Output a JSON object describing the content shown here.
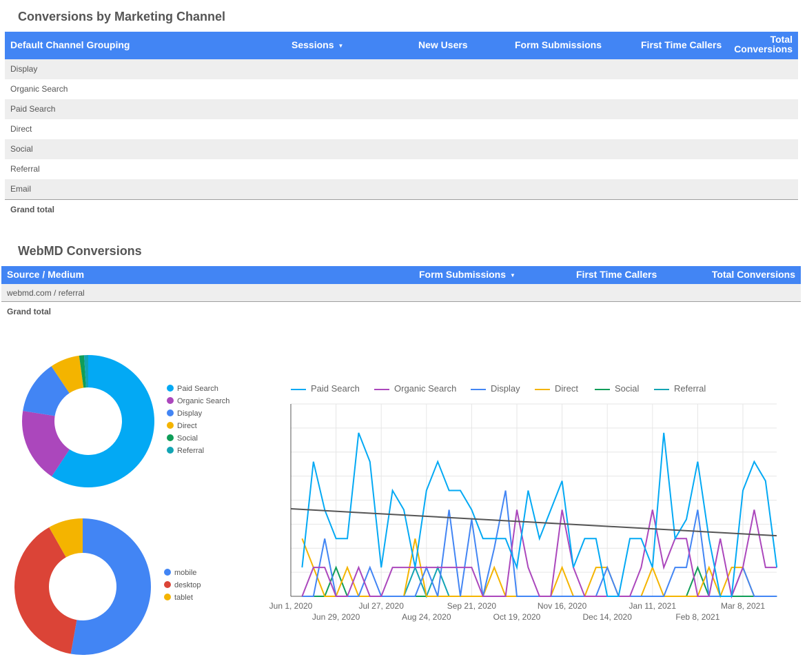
{
  "channel_table": {
    "title": "Conversions by Marketing Channel",
    "columns": [
      "Default Channel Grouping",
      "Sessions",
      "New Users",
      "Form Submissions",
      "First Time Callers",
      "Total",
      "Conversions"
    ],
    "sort_column": "Sessions",
    "rows": [
      "Display",
      "Organic Search",
      "Paid Search",
      "Direct",
      "Social",
      "Referral",
      "Email"
    ],
    "grand_total": "Grand total"
  },
  "webmd_table": {
    "title": "WebMD Conversions",
    "columns": [
      "Source / Medium",
      "Form Submissions",
      "First Time Callers",
      "Total Conversions"
    ],
    "sort_column": "Form Submissions",
    "rows": [
      "webmd.com / referral"
    ],
    "grand_total": "Grand total"
  },
  "colors": {
    "header_blue": "#4285f4",
    "paid_search": "#03a9f4",
    "organic_search": "#ab47bc",
    "display": "#4285f4",
    "direct": "#f4b400",
    "social": "#0f9d58",
    "referral": "#12a4b4",
    "mobile": "#4285f4",
    "desktop": "#db4437",
    "tablet": "#f4b400",
    "trend": "#555555"
  },
  "chart_data": [
    {
      "type": "pie",
      "variant": "donut",
      "title": "",
      "labels": [
        "Paid Search",
        "Organic Search",
        "Display",
        "Direct",
        "Social",
        "Referral"
      ],
      "values": [
        59.3,
        18.2,
        13.1,
        7.2,
        1.2,
        1.0
      ],
      "colors": [
        "#03a9f4",
        "#ab47bc",
        "#4285f4",
        "#f4b400",
        "#0f9d58",
        "#12a4b4"
      ],
      "legend": "right"
    },
    {
      "type": "pie",
      "variant": "donut",
      "title": "",
      "labels": [
        "mobile",
        "desktop",
        "tablet"
      ],
      "values": [
        52.8,
        39.0,
        8.2
      ],
      "colors": [
        "#4285f4",
        "#db4437",
        "#f4b400"
      ],
      "legend": "right"
    },
    {
      "type": "line",
      "title": "",
      "xlabel": "",
      "ylabel": "",
      "legend": "top",
      "grid": true,
      "x_tick_labels": [
        "Jun 1, 2020",
        "Jun 29, 2020",
        "Jul 27, 2020",
        "Aug 24, 2020",
        "Sep 21, 2020",
        "Oct 19, 2020",
        "Nov 16, 2020",
        "Dec 14, 2020",
        "Jan 11, 2021",
        "Feb 8, 2021",
        "Mar 8, 2021"
      ],
      "x_range_weeks": [
        0,
        43
      ],
      "ylim": [
        0,
        20
      ],
      "series": [
        {
          "name": "Paid Search",
          "color": "#03a9f4",
          "values": [
            3,
            14,
            9,
            6,
            6,
            17,
            14,
            3,
            11,
            9,
            3,
            11,
            14,
            11,
            11,
            9,
            6,
            6,
            6,
            3,
            11,
            6,
            9,
            12,
            3,
            6,
            6,
            0,
            0,
            6,
            6,
            3,
            17,
            6,
            8,
            14,
            6,
            0,
            0,
            11,
            14,
            12,
            3
          ]
        },
        {
          "name": "Organic Search",
          "color": "#ab47bc",
          "values": [
            0,
            3,
            3,
            0,
            0,
            3,
            0,
            0,
            3,
            3,
            3,
            3,
            3,
            3,
            3,
            3,
            0,
            0,
            0,
            9,
            3,
            0,
            0,
            9,
            3,
            0,
            0,
            0,
            0,
            0,
            3,
            9,
            3,
            6,
            6,
            0,
            0,
            6,
            0,
            3,
            9,
            3,
            3
          ]
        },
        {
          "name": "Display",
          "color": "#4285f4",
          "values": [
            0,
            0,
            6,
            0,
            0,
            0,
            3,
            0,
            0,
            0,
            0,
            3,
            0,
            9,
            0,
            8,
            0,
            5,
            11,
            0,
            0,
            0,
            0,
            0,
            0,
            0,
            0,
            3,
            0,
            0,
            0,
            0,
            0,
            3,
            3,
            9,
            0,
            0,
            0,
            3,
            0,
            0,
            0
          ]
        },
        {
          "name": "Direct",
          "color": "#f4b400",
          "values": [
            6,
            3,
            0,
            0,
            3,
            0,
            0,
            0,
            0,
            0,
            6,
            0,
            0,
            0,
            0,
            0,
            0,
            3,
            0,
            0,
            0,
            0,
            0,
            3,
            0,
            0,
            3,
            3,
            0,
            0,
            0,
            3,
            0,
            0,
            0,
            0,
            3,
            0,
            3,
            3,
            0,
            0,
            0
          ]
        },
        {
          "name": "Social",
          "color": "#0f9d58",
          "values": [
            0,
            0,
            0,
            3,
            0,
            0,
            0,
            0,
            0,
            0,
            0,
            0,
            0,
            0,
            0,
            0,
            0,
            0,
            0,
            0,
            0,
            0,
            0,
            0,
            0,
            0,
            0,
            0,
            0,
            0,
            0,
            0,
            0,
            0,
            0,
            3,
            0,
            0,
            0,
            0,
            0,
            0,
            0
          ]
        },
        {
          "name": "Referral",
          "color": "#12a4b4",
          "values": [
            0,
            0,
            0,
            0,
            0,
            0,
            0,
            0,
            0,
            0,
            3,
            0,
            3,
            0,
            0,
            0,
            0,
            0,
            0,
            0,
            0,
            0,
            0,
            0,
            0,
            0,
            0,
            0,
            0,
            0,
            0,
            0,
            0,
            0,
            0,
            0,
            0,
            0,
            0,
            0,
            0,
            0,
            0
          ]
        }
      ],
      "trendline": {
        "start": 9.1,
        "end": 6.3,
        "color": "#555555"
      }
    }
  ]
}
